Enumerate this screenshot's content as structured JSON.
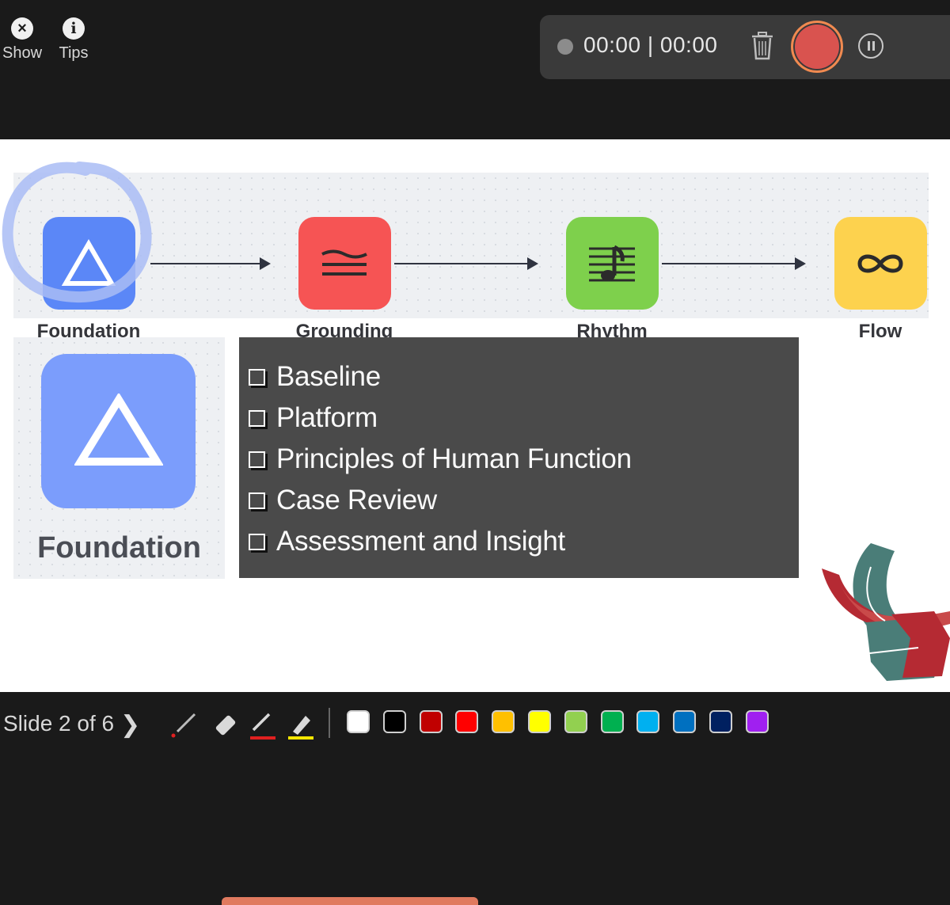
{
  "top_controls": {
    "show_label": "Show",
    "tips_label": "Tips"
  },
  "recorder": {
    "time": "00:00 | 00:00",
    "record_color": "#d9534f"
  },
  "slide": {
    "flow_steps": [
      {
        "label": "Foundation",
        "color": "#5b87f7",
        "icon": "triangle-icon"
      },
      {
        "label": "Grounding",
        "color": "#f65454",
        "icon": "wave-lines-icon"
      },
      {
        "label": "Rhythm",
        "color": "#7ed04c",
        "icon": "music-notes-icon"
      },
      {
        "label": "Flow",
        "color": "#fdd24e",
        "icon": "infinity-icon"
      }
    ],
    "card": {
      "label": "Foundation",
      "color": "#7b9dfc"
    },
    "checklist": [
      "Baseline",
      "Platform",
      "Principles of Human Function",
      "Case Review",
      "Assessment and Insight"
    ]
  },
  "toolbar": {
    "slide_counter": "Slide 2 of 6",
    "next_glyph": "❯",
    "tools": [
      "laser-pointer-icon",
      "eraser-icon",
      "red-pen-icon",
      "highlighter-icon"
    ],
    "colors": [
      "#ffffff",
      "#000000",
      "#c00000",
      "#ff0000",
      "#ffc000",
      "#ffff00",
      "#92d050",
      "#00b050",
      "#00b0f0",
      "#0070c0",
      "#002060",
      "#a020f0"
    ]
  }
}
